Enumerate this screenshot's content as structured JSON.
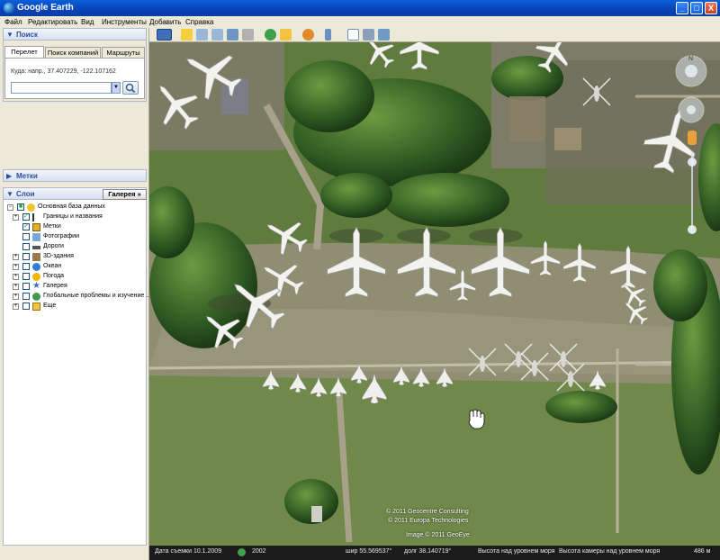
{
  "window": {
    "title": "Google Earth",
    "min_label": "_",
    "max_label": "□",
    "close_label": "X"
  },
  "menu": [
    "Файл",
    "Редактировать",
    "Вид",
    "Инструменты",
    "Добавить",
    "Справка"
  ],
  "search": {
    "header": "Поиск",
    "tabs": [
      "Перелет",
      "Поиск компаний",
      "Маршруты"
    ],
    "hint": "Куда: напр., 37.407229, -122.107162",
    "value": ""
  },
  "places": {
    "header": "Метки"
  },
  "layers": {
    "header": "Слои",
    "gallery_button": "Галерея »",
    "items": [
      {
        "label": "Основная база данных",
        "checked": true
      },
      {
        "label": "Границы и названия",
        "checked": true
      },
      {
        "label": "Метки",
        "checked": true
      },
      {
        "label": "Фотографии",
        "checked": false
      },
      {
        "label": "Дороги",
        "checked": false
      },
      {
        "label": "3D-здания",
        "checked": false
      },
      {
        "label": "Океан",
        "checked": false
      },
      {
        "label": "Погода",
        "checked": false
      },
      {
        "label": "Галерея",
        "checked": false
      },
      {
        "label": "Глобальные проблемы и изучение ...",
        "checked": false
      },
      {
        "label": "Еще",
        "checked": false
      }
    ]
  },
  "map": {
    "copyrights": [
      "© 2011 Geocentre Consulting",
      "© 2011 Europa Technologies",
      "Image © 2011 GeoEye"
    ]
  },
  "status": {
    "imagery_date": "Дата съемки  10.1.2009",
    "year": "2002",
    "lat": "шир    55.569537°",
    "lon": "долг    38.140719°",
    "elevation": "Высота над уровнем моря",
    "eye_alt": "Высота камеры над уровнем моря",
    "scale": "486 м"
  }
}
